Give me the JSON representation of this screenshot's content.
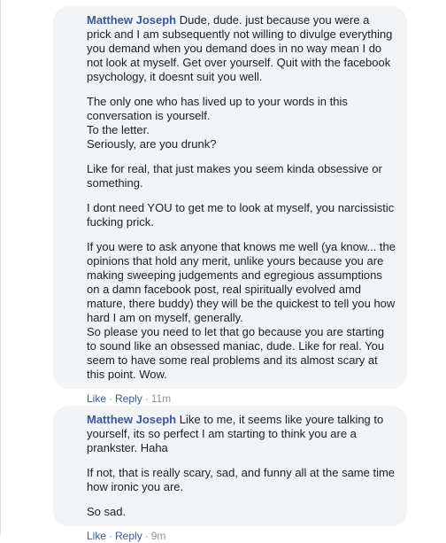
{
  "comments": [
    {
      "author": "Matthew Joseph",
      "paragraphs": [
        "Dude, dude. just because you were a prick and I am subsequently not willing to divulge everything you demand when you demand does in no way mean I do not look at myself. Get over yourself. Quit with the facebook psychology, it doesnt suit you well.",
        "The only one who has lived up to your words in this conversation is yourself.\nTo the letter.\nSeriously, are you drunk?",
        "Like for real, that just makes you seem kinda obsessive or something.",
        "I dont need YOU to get me to look at myself, you narcissistic fucking prick.",
        "If you were to ask anyone that knows me well (ya know... the opinions that hold any merit, unlike yours because you are making sweeping judgements and egregious assumptions on a damn facebook post, real spiritually evolved amd mature, there buddy) they will be the quickest to tell you how hard I am on myself, generally.\nSo please you need to let that go because you are starting to sound like an obsessed maniac, dude. Like for real. You seem to have some real problems and its almost scary at this point. Wow."
      ],
      "actions": {
        "like": "Like",
        "reply": "Reply",
        "time": "11m"
      }
    },
    {
      "author": "Matthew Joseph",
      "paragraphs": [
        "Like to me, it seems like youre talking to yourself, its so perfect I am starting to think you are a prankster. Haha",
        "If not, that is really scary, sad, and funny all at the same time how ironic you are.",
        "So sad."
      ],
      "actions": {
        "like": "Like",
        "reply": "Reply",
        "time": "9m"
      }
    }
  ]
}
